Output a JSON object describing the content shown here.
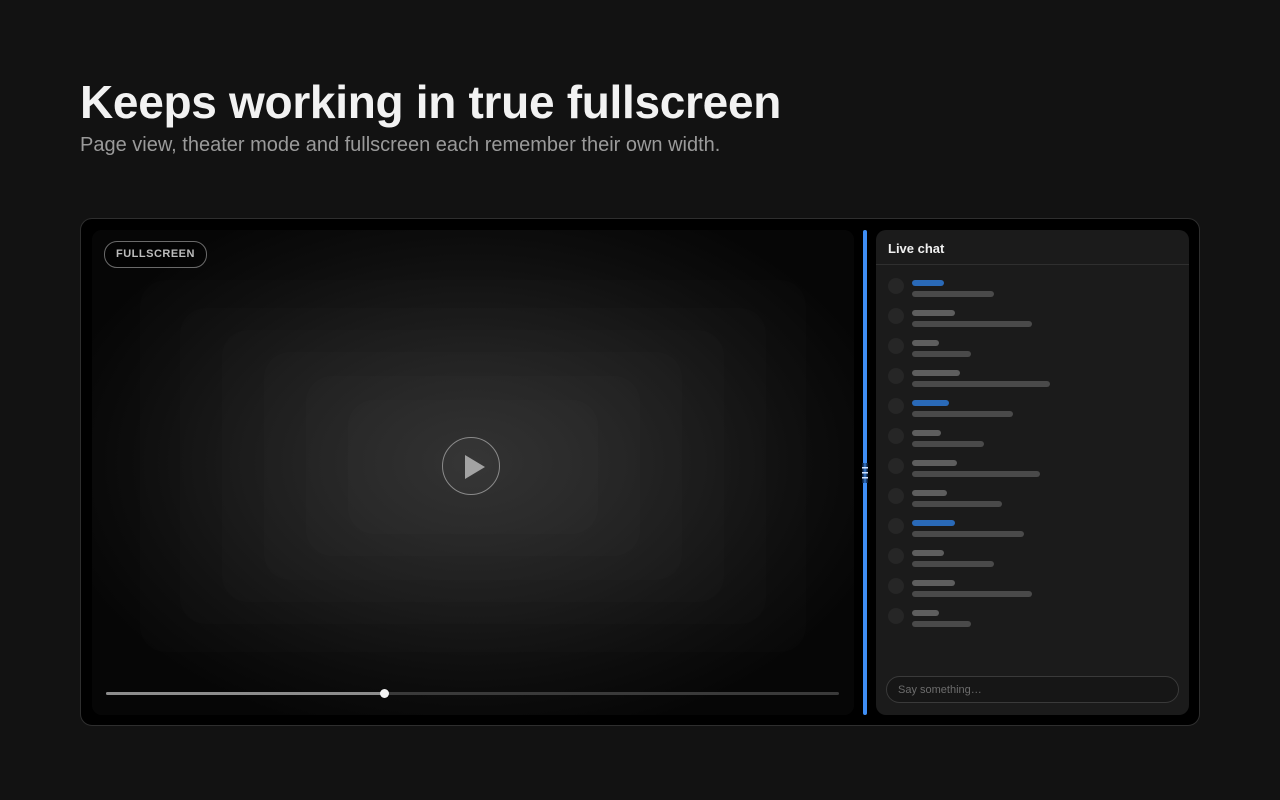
{
  "hero": {
    "title": "Keeps working in true fullscreen",
    "subtitle": "Page view, theater mode and fullscreen each remember their own width."
  },
  "player": {
    "mode_badge": "FULLSCREEN",
    "progress_fraction": 0.38,
    "play_icon": "play-icon"
  },
  "divider": {
    "icon": "grip-icon",
    "color": "#3f8ef5"
  },
  "chat": {
    "title": "Live chat",
    "input_placeholder": "Say something…",
    "colors": {
      "name_default": "#5e5e5e",
      "name_highlight": "#2a6ab8",
      "message": "#4a4a4a"
    },
    "messages": [
      {
        "highlight": true,
        "name_len": 0.12,
        "msg_len": 0.31
      },
      {
        "highlight": false,
        "name_len": 0.16,
        "msg_len": 0.45
      },
      {
        "highlight": false,
        "name_len": 0.1,
        "msg_len": 0.22
      },
      {
        "highlight": false,
        "name_len": 0.18,
        "msg_len": 0.52
      },
      {
        "highlight": true,
        "name_len": 0.14,
        "msg_len": 0.38
      },
      {
        "highlight": false,
        "name_len": 0.11,
        "msg_len": 0.27
      },
      {
        "highlight": false,
        "name_len": 0.17,
        "msg_len": 0.48
      },
      {
        "highlight": false,
        "name_len": 0.13,
        "msg_len": 0.34
      },
      {
        "highlight": true,
        "name_len": 0.16,
        "msg_len": 0.42
      },
      {
        "highlight": false,
        "name_len": 0.12,
        "msg_len": 0.31
      },
      {
        "highlight": false,
        "name_len": 0.16,
        "msg_len": 0.45
      },
      {
        "highlight": false,
        "name_len": 0.1,
        "msg_len": 0.22
      }
    ]
  }
}
